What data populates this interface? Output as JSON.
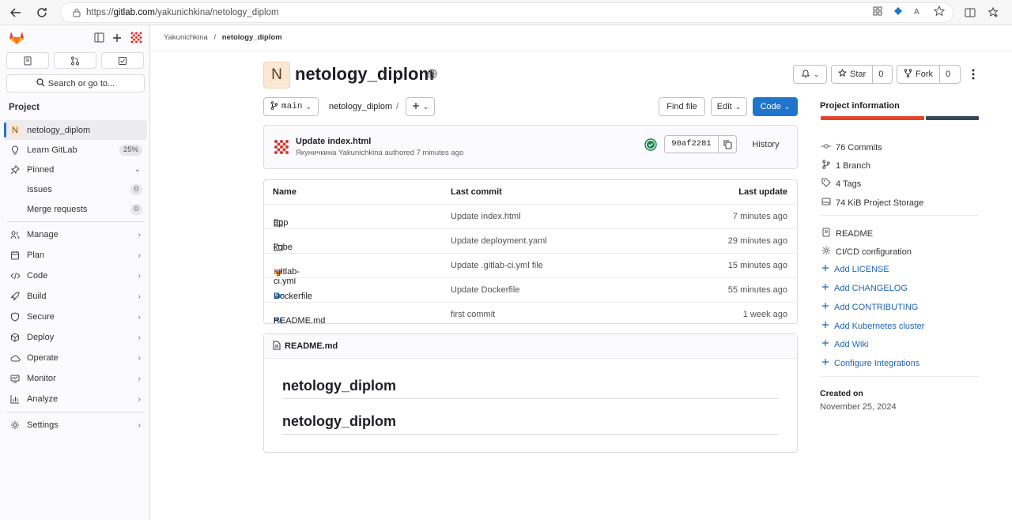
{
  "browser": {
    "url_prefix": "https://",
    "url_host": "gitlab.com",
    "url_path": "/yakunichkina/netology_diplom"
  },
  "sidebar": {
    "search_label": "Search or go to...",
    "section_title": "Project",
    "project_avatar_letter": "N",
    "items": [
      {
        "label": "netology_diplom"
      },
      {
        "label": "Learn GitLab",
        "badge": "25%"
      },
      {
        "label": "Pinned"
      },
      {
        "label": "Issues",
        "badge": "0"
      },
      {
        "label": "Merge requests",
        "badge": "0"
      },
      {
        "label": "Manage"
      },
      {
        "label": "Plan"
      },
      {
        "label": "Code"
      },
      {
        "label": "Build"
      },
      {
        "label": "Secure"
      },
      {
        "label": "Deploy"
      },
      {
        "label": "Operate"
      },
      {
        "label": "Monitor"
      },
      {
        "label": "Analyze"
      },
      {
        "label": "Settings"
      }
    ]
  },
  "breadcrumb": {
    "user": "Yakunichkina",
    "separator": "/",
    "project": "netology_diplom"
  },
  "project": {
    "avatar_letter": "N",
    "title": "netology_diplom",
    "star_label": "Star",
    "star_count": "0",
    "fork_label": "Fork",
    "fork_count": "0"
  },
  "toolbar": {
    "branch": "main",
    "path": "netology_diplom",
    "path_sep": "/",
    "find_file": "Find file",
    "edit": "Edit",
    "code": "Code"
  },
  "commit": {
    "title": "Update index.html",
    "author_line": "Якуничкина Yakunichkina authored 7 minutes ago",
    "sha": "90af2281",
    "history": "History"
  },
  "files": {
    "headers": {
      "name": "Name",
      "last_commit": "Last commit",
      "last_update": "Last update"
    },
    "rows": [
      {
        "name": "app",
        "icon": "folder-icon",
        "commit": "Update index.html",
        "updated": "7 minutes ago"
      },
      {
        "name": "kube",
        "icon": "folder-icon",
        "commit": "Update deployment.yaml",
        "updated": "29 minutes ago"
      },
      {
        "name": ".gitlab-ci.yml",
        "icon": "gitlab-icon",
        "commit": "Update .gitlab-ci.yml file",
        "updated": "15 minutes ago"
      },
      {
        "name": "Dockerfile",
        "icon": "docker-icon",
        "commit": "Update Dockerfile",
        "updated": "55 minutes ago"
      },
      {
        "name": "README.md",
        "icon": "markdown-icon",
        "commit": "first commit",
        "updated": "1 week ago"
      }
    ]
  },
  "readme": {
    "file": "README.md",
    "heading1": "netology_diplom",
    "heading2": "netology_diplom"
  },
  "info": {
    "title": "Project information",
    "language_bar": [
      {
        "color": "#e24329",
        "share": 0.66
      },
      {
        "color": "#34495e",
        "share": 0.34
      }
    ],
    "stats": [
      "76 Commits",
      "1 Branch",
      "4 Tags",
      "74 KiB Project Storage"
    ],
    "docs": [
      "README",
      "CI/CD configuration"
    ],
    "links": [
      "Add LICENSE",
      "Add CHANGELOG",
      "Add CONTRIBUTING",
      "Add Kubernetes cluster",
      "Add Wiki",
      "Configure Integrations"
    ],
    "created_label": "Created on",
    "created_date": "November 25, 2024"
  },
  "colors": {
    "accent": "#1f75cb",
    "success": "#108548",
    "link": "#1f65b9"
  }
}
